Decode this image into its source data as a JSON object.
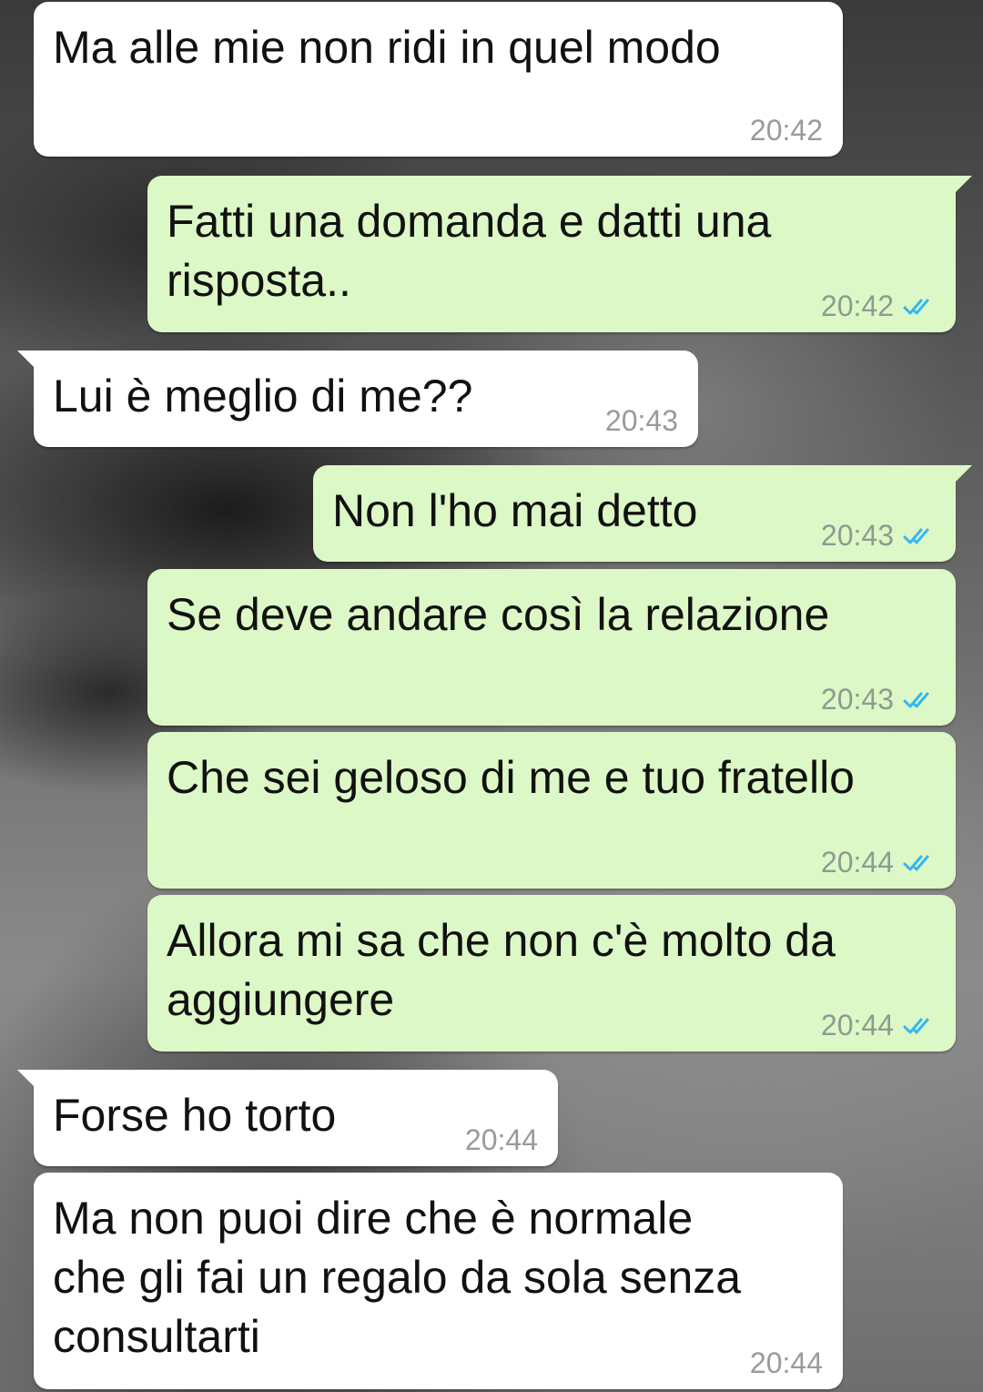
{
  "messages": [
    {
      "direction": "in",
      "text": "Ma alle mie non ridi in quel modo",
      "time": "20:42"
    },
    {
      "direction": "out",
      "text": "Fatti una domanda e datti una\nrisposta..",
      "time": "20:42",
      "status": "read"
    },
    {
      "direction": "in",
      "text": "Lui è meglio di me??",
      "time": "20:43"
    },
    {
      "direction": "out",
      "text": "Non l'ho mai detto",
      "time": "20:43",
      "status": "read"
    },
    {
      "direction": "out",
      "text": "Se deve andare così la relazione",
      "time": "20:43",
      "status": "read"
    },
    {
      "direction": "out",
      "text": "Che sei geloso di me e tuo fratello",
      "time": "20:44",
      "status": "read"
    },
    {
      "direction": "out",
      "text": "Allora mi sa che non c'è molto da\naggiungere",
      "time": "20:44",
      "status": "read"
    },
    {
      "direction": "in",
      "text": "Forse ho torto",
      "time": "20:44"
    },
    {
      "direction": "in",
      "text": "Ma non puoi dire che è normale\nche gli fai un regalo da sola senza\nconsultarti",
      "time": "20:44"
    }
  ],
  "icons": {
    "read_receipt": "double-check-icon",
    "read_receipt_color": "#34b7f1"
  },
  "colors": {
    "incoming_bubble": "#ffffff",
    "outgoing_bubble": "#dcf8c6"
  }
}
